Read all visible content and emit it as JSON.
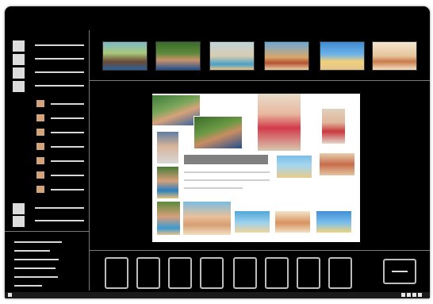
{
  "window": {
    "title": ""
  },
  "colors": {
    "background": "#000000",
    "panel_line": "#d8d8d8",
    "folder_accent": "#d3a47c",
    "canvas": "#ffffff",
    "text_block": "#808080"
  },
  "icons": {
    "menu_square": "square-icon",
    "folder": "folder-icon",
    "slot": "empty-slot-icon",
    "ok": "minus-icon"
  },
  "sidebar": {
    "top_items": 4,
    "folder_items": 8,
    "bottom_items": 2
  },
  "thumbnails": [
    {
      "label": ""
    },
    {
      "label": ""
    },
    {
      "label": ""
    },
    {
      "label": ""
    },
    {
      "label": ""
    },
    {
      "label": ""
    }
  ],
  "layout_slots": 8
}
